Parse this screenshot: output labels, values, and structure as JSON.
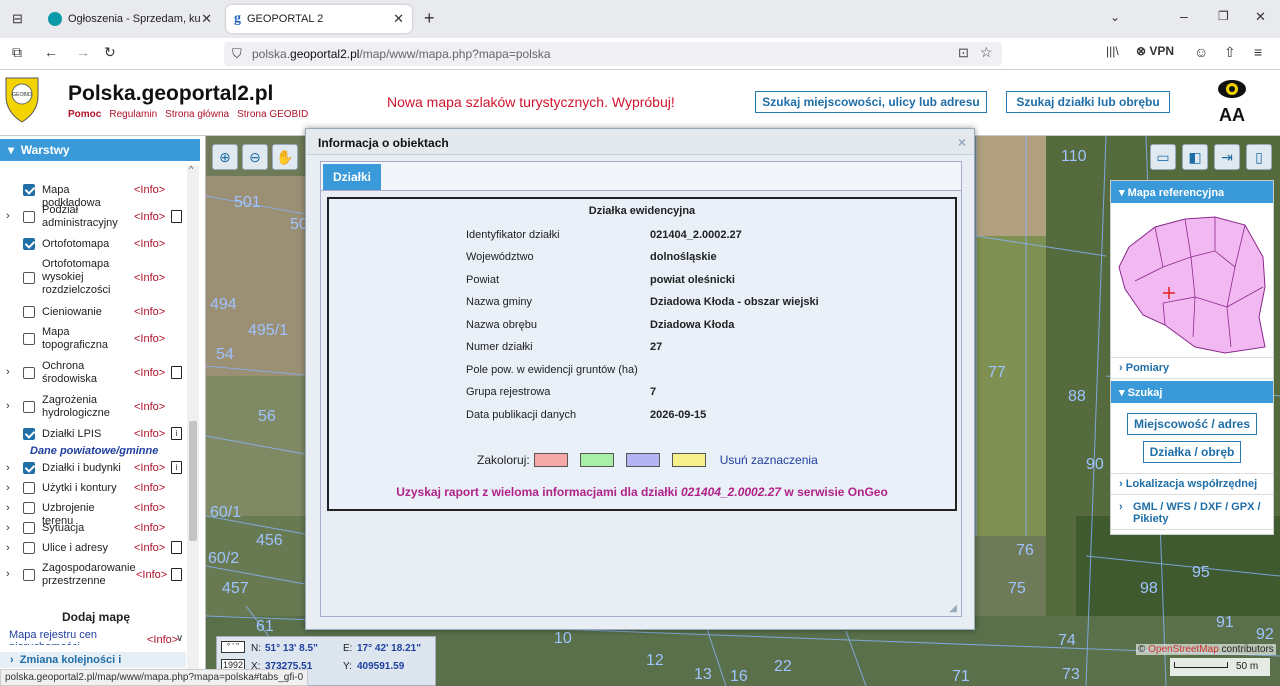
{
  "browser": {
    "tabs": [
      {
        "title": "Ogłoszenia - Sprzedam, kupię n",
        "favicon_color": "#0a9aa8"
      },
      {
        "title": "GEOPORTAL 2",
        "favicon_color": "#2060c0"
      }
    ],
    "url_prefix": "polska.",
    "url_domain": "geoportal2.pl",
    "url_path": "/map/www/mapa.php?mapa=polska",
    "vpn_label": "VPN",
    "status_url": "polska.geoportal2.pl/map/www/mapa.php?mapa=polska#tabs_gfi-0"
  },
  "header": {
    "logo_text": "GEOBID",
    "title": "Polska.geoportal2.pl",
    "links": [
      "Pomoc",
      "Regulamin",
      "Strona główna",
      "Strona GEOBID"
    ],
    "promo": "Nowa mapa szlaków turystycznych. Wypróbuj!",
    "search_address_btn": "Szukaj miejscowości, ulicy lub adresu",
    "search_parcel_btn": "Szukaj działki lub obrębu",
    "font_size_label": "AA"
  },
  "layers": {
    "title": "Warstwy",
    "info_label": "<Info>",
    "items": [
      {
        "label": "Mapa podkładowa",
        "checked": true
      },
      {
        "label": "Podział administracyjny",
        "checked": false
      },
      {
        "label": "Ortofotomapa",
        "checked": true
      },
      {
        "label": "Ortofotomapa wysokiej rozdzielczości",
        "checked": false
      },
      {
        "label": "Cieniowanie",
        "checked": false
      },
      {
        "label": "Mapa topograficzna",
        "checked": false
      },
      {
        "label": "Ochrona środowiska",
        "checked": false
      },
      {
        "label": "Zagrożenia hydrologiczne",
        "checked": false
      },
      {
        "label": "Działki LPIS",
        "checked": true
      },
      {
        "label": "Działki i budynki",
        "checked": true
      },
      {
        "label": "Użytki i kontury",
        "checked": false
      },
      {
        "label": "Uzbrojenie terenu",
        "checked": false
      },
      {
        "label": "Sytuacja",
        "checked": false
      },
      {
        "label": "Ulice i adresy",
        "checked": false
      },
      {
        "label": "Zagospodarowanie przestrzenne",
        "checked": false
      }
    ],
    "section_label": "Dane powiatowe/gminne",
    "add_map": "Dodaj mapę",
    "registry_map": "Mapa rejestru cen nieruchomości",
    "change_order": "Zmiana kolejności i"
  },
  "modal": {
    "title": "Informacja o obiektach",
    "close": "×",
    "tab_label": "Działki",
    "card_title": "Działka ewidencyjna",
    "fields": [
      {
        "label": "Identyfikator działki",
        "value": "021404_2.0002.27"
      },
      {
        "label": "Województwo",
        "value": "dolnośląskie"
      },
      {
        "label": "Powiat",
        "value": "powiat oleśnicki"
      },
      {
        "label": "Nazwa gminy",
        "value": "Dziadowa Kłoda - obszar wiejski"
      },
      {
        "label": "Nazwa obrębu",
        "value": "Dziadowa Kłoda"
      },
      {
        "label": "Numer działki",
        "value": "27"
      },
      {
        "label": "Pole pow. w ewidencji gruntów (ha)",
        "value": ""
      },
      {
        "label": "Grupa rejestrowa",
        "value": "7"
      },
      {
        "label": "Data publikacji danych",
        "value": "2026-09-15"
      }
    ],
    "colorize_label": "Zakoloruj:",
    "colors": [
      "#f4a8a8",
      "#a8f0a8",
      "#b4b4f4",
      "#f8f08a"
    ],
    "clear_label": "Usuń zaznaczenia",
    "report_prefix": "Uzyskaj raport z wieloma informacjami dla działki ",
    "report_id": "021404_2.0002.27",
    "report_suffix": " w serwisie OnGeo"
  },
  "right_panel": {
    "ref_map": "Mapa referencyjna",
    "measurements": "Pomiary",
    "search": "Szukaj",
    "btn_place": "Miejscowość / adres",
    "btn_parcel": "Działka / obręb",
    "coord_loc": "Lokalizacja współrzędnej",
    "formats": "GML / WFS / DXF / GPX / Pikiety"
  },
  "map": {
    "parcel_labels": [
      "501",
      "50",
      "494",
      "495/1",
      "54",
      "56",
      "60/1",
      "456",
      "60/2",
      "457",
      "61",
      "10",
      "12",
      "13",
      "16",
      "22",
      "110",
      "77",
      "88",
      "90",
      "76",
      "75",
      "98",
      "91",
      "92",
      "74",
      "73",
      "71",
      "95"
    ],
    "attribution": "contributors",
    "scale": "50 m"
  },
  "coords": {
    "dms_label": "° ' \"",
    "epsg": "1992",
    "n_label": "N:",
    "n_val": "51° 13' 8.5\"",
    "e_label": "E:",
    "e_val": "17° 42' 18.21\"",
    "x_label": "X:",
    "x_val": "373275.51",
    "y_label": "Y:",
    "y_val": "409591.59"
  }
}
